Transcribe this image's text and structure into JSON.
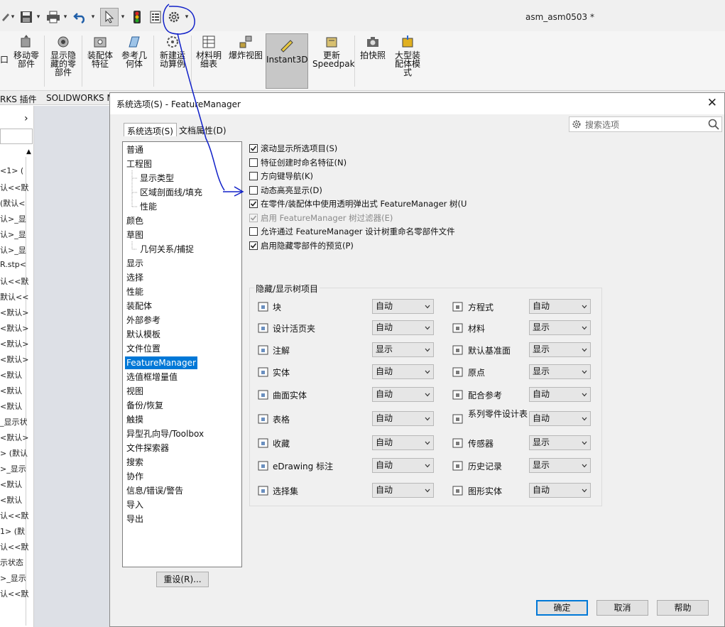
{
  "window": {
    "title": "asm_asm0503 *"
  },
  "ribbon": {
    "items": [
      {
        "label": "口"
      },
      {
        "label": "移动零部件"
      },
      {
        "label": "显示隐藏的零部件"
      },
      {
        "label": "装配体特征"
      },
      {
        "label": "参考几何体"
      },
      {
        "label": "新建运动算例"
      },
      {
        "label": "材料明细表"
      },
      {
        "label": "爆炸视图"
      },
      {
        "label": "Instant3D"
      },
      {
        "label": "更新Speedpak"
      },
      {
        "label": "拍快照"
      },
      {
        "label": "大型装配体模式"
      }
    ]
  },
  "tabs": {
    "plugins": "RKS 插件",
    "mbd": "SOLIDWORKS MB"
  },
  "left_panel": {
    "lines": [
      "<1> (",
      "认<<默",
      "(默认<",
      "认>_显",
      "认>_显",
      "认>_显",
      "R.stp<",
      "认<<默",
      "默认<<",
      "<默认>",
      "<默认>",
      "<默认>",
      "<默认>",
      "<默认",
      "<默认",
      "<默认",
      "_显示状",
      "<默认>",
      "> (默认",
      ">_显示",
      "<默认",
      "<默认",
      "认<<默",
      "1> (默",
      "认<<默",
      "示状态",
      ">_显示",
      "认<<默"
    ]
  },
  "dialog": {
    "title": "系统选项(S) - FeatureManager",
    "close_glyph": "✕",
    "tabs": {
      "system": "系统选项(S)",
      "document": "文档属性(D)"
    },
    "search": {
      "placeholder": "搜索选项"
    },
    "tree": [
      {
        "label": "普通"
      },
      {
        "label": "工程图"
      },
      {
        "label": "显示类型"
      },
      {
        "label": "区域剖面线/填充"
      },
      {
        "label": "性能"
      },
      {
        "label": "颜色"
      },
      {
        "label": "草图"
      },
      {
        "label": "几何关系/捕捉"
      },
      {
        "label": "显示"
      },
      {
        "label": "选择"
      },
      {
        "label": "性能"
      },
      {
        "label": "装配体"
      },
      {
        "label": "外部参考"
      },
      {
        "label": "默认模板"
      },
      {
        "label": "文件位置"
      },
      {
        "label": "FeatureManager"
      },
      {
        "label": "选值框增量值"
      },
      {
        "label": "视图"
      },
      {
        "label": "备份/恢复"
      },
      {
        "label": "触摸"
      },
      {
        "label": "异型孔向导/Toolbox"
      },
      {
        "label": "文件探索器"
      },
      {
        "label": "搜索"
      },
      {
        "label": "协作"
      },
      {
        "label": "信息/错误/警告"
      },
      {
        "label": "导入"
      },
      {
        "label": "导出"
      }
    ],
    "checks": [
      {
        "label": "滚动显示所选项目(S)",
        "checked": true
      },
      {
        "label": "特征创建时命名特征(N)",
        "checked": false
      },
      {
        "label": "方向键导航(K)",
        "checked": false
      },
      {
        "label": "动态高亮显示(D)",
        "checked": false
      },
      {
        "label": "在零件/装配体中使用透明弹出式 FeatureManager 树(U",
        "checked": true
      },
      {
        "label": "启用 FeatureManager 树过滤器(E)",
        "checked": true,
        "disabled": true
      },
      {
        "label": "允许通过 FeatureManager 设计树重命名零部件文件",
        "checked": false
      },
      {
        "label": "启用隐藏零部件的预览(P)",
        "checked": true
      }
    ],
    "tree_items_group": {
      "label": "隐藏/显示树项目",
      "left": [
        {
          "label": "块",
          "value": "自动"
        },
        {
          "label": "设计活页夹",
          "value": "自动"
        },
        {
          "label": "注解",
          "value": "显示"
        },
        {
          "label": "实体",
          "value": "自动"
        },
        {
          "label": "曲面实体",
          "value": "自动"
        },
        {
          "label": "表格",
          "value": "自动"
        },
        {
          "label": "收藏",
          "value": "自动"
        },
        {
          "label": "eDrawing 标注",
          "value": "自动"
        },
        {
          "label": "选择集",
          "value": "自动"
        }
      ],
      "right": [
        {
          "label": "方程式",
          "value": "自动"
        },
        {
          "label": "材料",
          "value": "显示"
        },
        {
          "label": "默认基准面",
          "value": "显示"
        },
        {
          "label": "原点",
          "value": "显示"
        },
        {
          "label": "配合参考",
          "value": "自动"
        },
        {
          "label": "系列零件设计表",
          "value": "自动"
        },
        {
          "label": "传感器",
          "value": "显示"
        },
        {
          "label": "历史记录",
          "value": "显示"
        },
        {
          "label": "图形实体",
          "value": "自动"
        }
      ]
    },
    "buttons": {
      "reset": "重设(R)...",
      "ok": "确定",
      "cancel": "取消",
      "help": "帮助"
    }
  },
  "colors": {
    "accent": "#0078d7",
    "annotation": "#1020c8"
  }
}
